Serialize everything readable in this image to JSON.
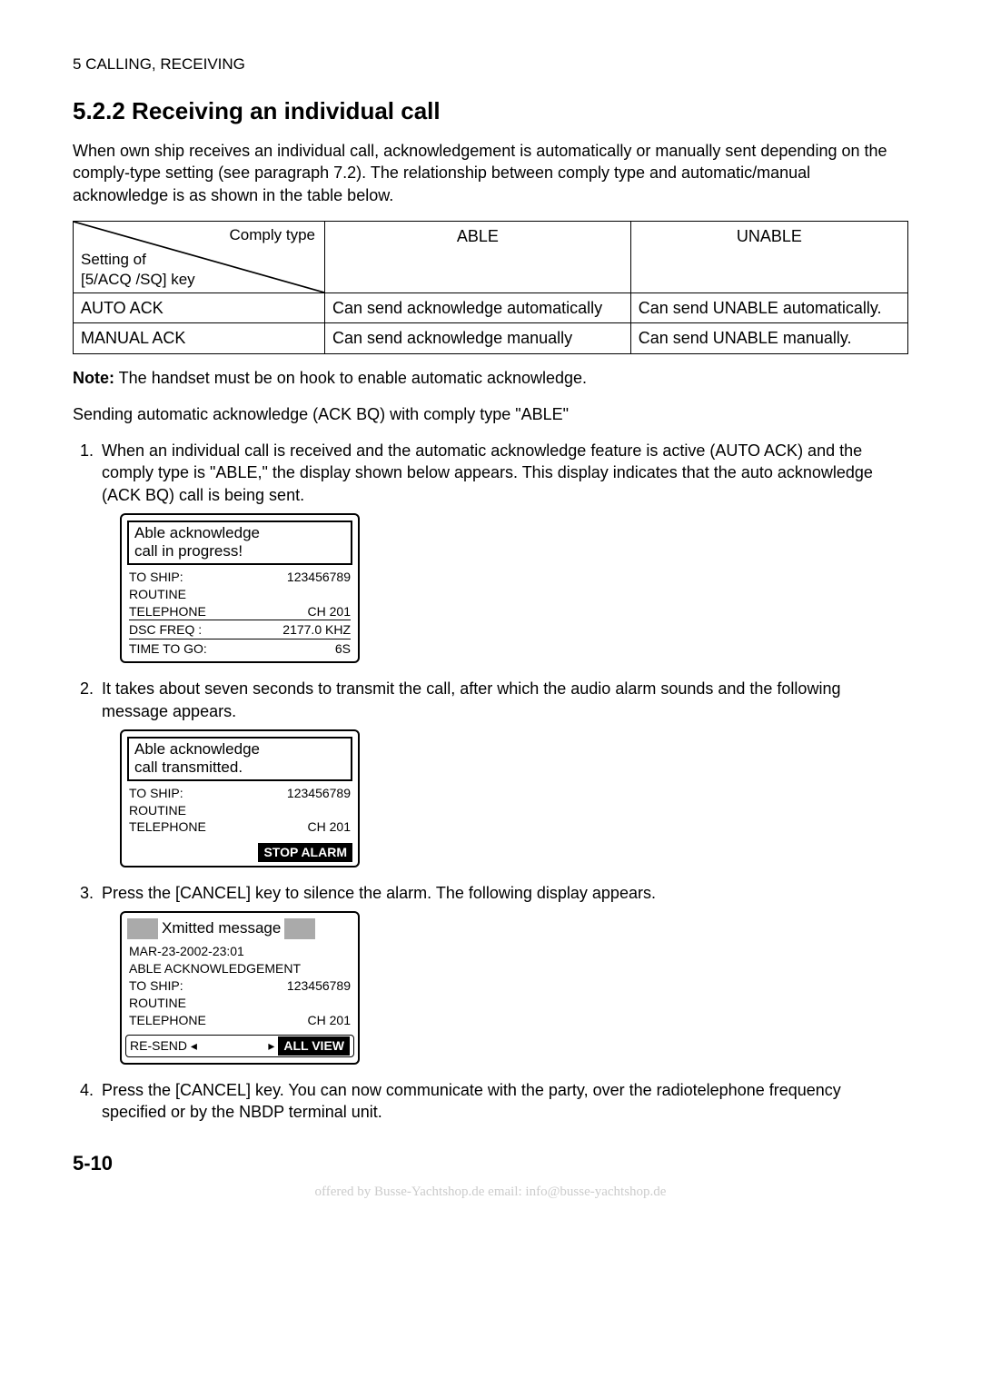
{
  "chapterHeader": "5   CALLING, RECEIVING",
  "sectionTitle": "5.2.2 Receiving an individual call",
  "intro": "When own ship receives an individual call, acknowledgement is automatically or manually sent depending on the comply-type setting (see paragraph 7.2). The relationship between comply type and automatic/manual acknowledge is as shown in the table below.",
  "table": {
    "diagTop": "Comply type",
    "diagBot": "Setting of\n[5/ACQ /SQ] key",
    "col1": "ABLE",
    "col2": "UNABLE",
    "rows": [
      {
        "h": "AUTO ACK",
        "c1": "Can send acknowledge automatically",
        "c2": "Can send UNABLE automatically."
      },
      {
        "h": "MANUAL ACK",
        "c1": "Can send acknowledge manually",
        "c2": "Can send UNABLE manually."
      }
    ]
  },
  "noteLabel": "Note:",
  "noteText": " The handset must be on hook to enable automatic acknowledge.",
  "subheading": "Sending automatic acknowledge (ACK BQ) with comply type \"ABLE\"",
  "steps": {
    "s1": "When an individual call is received and the automatic acknowledge feature is active (AUTO ACK) and the comply type is \"ABLE,\" the display shown below appears. This display indicates that the auto acknowledge (ACK BQ) call is being sent.",
    "s2": "It takes about seven seconds to transmit the call, after which the audio alarm sounds and the following message appears.",
    "s3": "Press the [CANCEL] key to silence the alarm. The following display appears.",
    "s4": "Press the [CANCEL] key. You can now communicate with the party, over the radiotelephone frequency specified or by the NBDP terminal unit."
  },
  "lcd1": {
    "titleLine1": "Able acknowledge",
    "titleLine2": "call in progress!",
    "toShipLabel": "TO SHIP:",
    "toShipVal": "123456789",
    "routine": "ROUTINE",
    "telLabel": "TELEPHONE",
    "telVal": "CH 201",
    "dscLabel": "DSC FREQ  :",
    "dscVal": "2177.0 KHZ",
    "timeLabel": "TIME TO GO:",
    "timeVal": "6S"
  },
  "lcd2": {
    "titleLine1": "Able acknowledge",
    "titleLine2": "call transmitted.",
    "toShipLabel": "TO SHIP:",
    "toShipVal": "123456789",
    "routine": "ROUTINE",
    "telLabel": "TELEPHONE",
    "telVal": "CH 201",
    "stopAlarm": "STOP ALARM"
  },
  "lcd3": {
    "title": "Xmitted message",
    "timestamp": "MAR-23-2002-23:01",
    "ack": "ABLE ACKNOWLEDGEMENT",
    "toShipLabel": "TO SHIP:",
    "toShipVal": "123456789",
    "routine": "ROUTINE",
    "telLabel": "TELEPHONE",
    "telVal": "CH 201",
    "resend": "RE-SEND ◂",
    "arrow": "▸",
    "allView": "ALL VIEW"
  },
  "pageNumber": "5-10",
  "footer": "offered by Busse-Yachtshop.de      email: info@busse-yachtshop.de"
}
